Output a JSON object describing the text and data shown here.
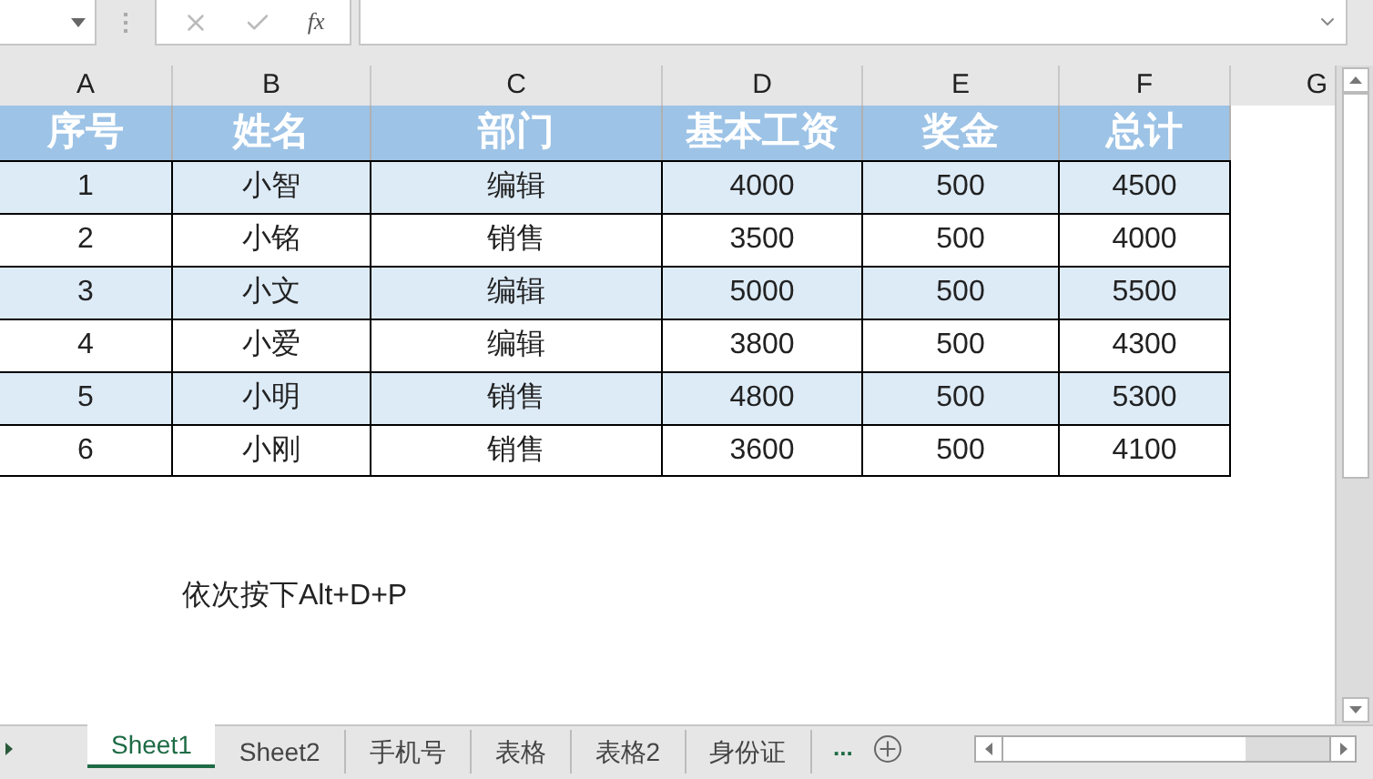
{
  "formula_bar": {
    "function_label": "fx"
  },
  "column_headers": [
    "A",
    "B",
    "C",
    "D",
    "E",
    "F",
    "G"
  ],
  "table": {
    "columns": [
      "序号",
      "姓名",
      "部门",
      "基本工资",
      "奖金",
      "总计"
    ],
    "rows": [
      [
        "1",
        "小智",
        "编辑",
        "4000",
        "500",
        "4500"
      ],
      [
        "2",
        "小铭",
        "销售",
        "3500",
        "500",
        "4000"
      ],
      [
        "3",
        "小文",
        "编辑",
        "5000",
        "500",
        "5500"
      ],
      [
        "4",
        "小爱",
        "编辑",
        "3800",
        "500",
        "4300"
      ],
      [
        "5",
        "小明",
        "销售",
        "4800",
        "500",
        "5300"
      ],
      [
        "6",
        "小刚",
        "销售",
        "3600",
        "500",
        "4100"
      ]
    ]
  },
  "note": "依次按下Alt+D+P",
  "sheet_tabs": [
    {
      "label": "Sheet1",
      "selected": true
    },
    {
      "label": "Sheet2",
      "selected": false
    },
    {
      "label": "手机号",
      "selected": false
    },
    {
      "label": "表格",
      "selected": false
    },
    {
      "label": "表格2",
      "selected": false
    },
    {
      "label": "身份证",
      "selected": false
    }
  ],
  "more_tabs": "..."
}
